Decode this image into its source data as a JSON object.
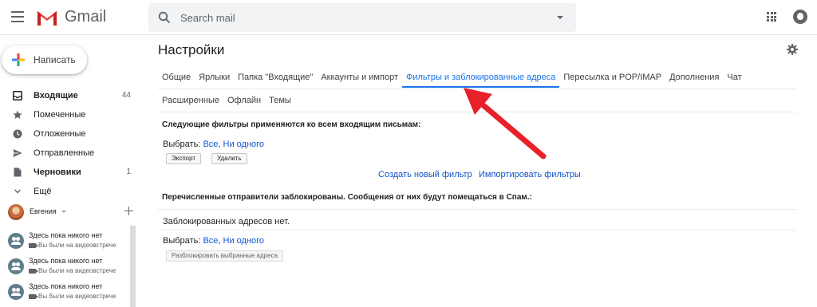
{
  "app": {
    "name": "Gmail"
  },
  "search": {
    "placeholder": "Search mail"
  },
  "compose": {
    "label": "Написать"
  },
  "nav": [
    {
      "label": "Входящие",
      "count": "44",
      "bold": true,
      "icon": "inbox-icon"
    },
    {
      "label": "Помеченные",
      "count": "",
      "bold": false,
      "icon": "star-icon"
    },
    {
      "label": "Отложенные",
      "count": "",
      "bold": false,
      "icon": "clock-icon"
    },
    {
      "label": "Отправленные",
      "count": "",
      "bold": false,
      "icon": "send-icon"
    },
    {
      "label": "Черновики",
      "count": "1",
      "bold": true,
      "icon": "draft-icon"
    },
    {
      "label": "Ещё",
      "count": "",
      "bold": false,
      "icon": "chevron-down-icon"
    }
  ],
  "hangouts": {
    "user": "Евгения",
    "items": [
      {
        "title": "Здесь пока никого нет",
        "sub": "Вы были на видеовстрече"
      },
      {
        "title": "Здесь пока никого нет",
        "sub": "Вы были на видеовстрече"
      },
      {
        "title": "Здесь пока никого нет",
        "sub": "Вы были на видеовстрече"
      }
    ]
  },
  "settings": {
    "title": "Настройки",
    "tabs_row1": [
      "Общие",
      "Ярлыки",
      "Папка \"Входящие\"",
      "Аккаунты и импорт",
      "Фильтры и заблокированные адреса",
      "Пересылка и POP/IMAP",
      "Дополнения",
      "Чат"
    ],
    "tabs_row2": [
      "Расширенные",
      "Офлайн",
      "Темы"
    ],
    "active_tab": "Фильтры и заблокированные адреса"
  },
  "filters": {
    "heading": "Следующие фильтры применяются ко всем входящим письмам:",
    "select_label": "Выбрать:",
    "select_all": "Все",
    "select_none": "Ни одного",
    "export_btn": "Экспорт",
    "delete_btn": "Удалить",
    "create_link": "Создать новый фильтр",
    "import_link": "Импортировать фильтры"
  },
  "blocked": {
    "heading": "Перечисленные отправители заблокированы. Сообщения от них будут помещаться в Спам.:",
    "empty_text": "Заблокированных адресов нет.",
    "select_label": "Выбрать:",
    "select_all": "Все",
    "select_none": "Ни одного",
    "unblock_btn": "Разблокировать выбранные адреса"
  },
  "colors": {
    "accent": "#1a73e8",
    "link": "#1155cc",
    "arrow": "#e8202a"
  }
}
